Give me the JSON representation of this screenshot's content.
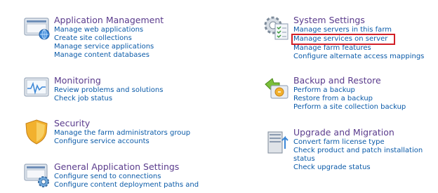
{
  "colors": {
    "title": "#5a3b8c",
    "link": "#0a5aa8",
    "highlight_border": "#d21f27"
  },
  "sections": {
    "app_mgmt": {
      "icon": "application-management-icon",
      "title": "Application Management",
      "links": [
        "Manage web applications",
        "Create site collections",
        "Manage service applications",
        "Manage content databases"
      ]
    },
    "monitoring": {
      "icon": "monitoring-icon",
      "title": "Monitoring",
      "links": [
        "Review problems and solutions",
        "Check job status"
      ]
    },
    "security": {
      "icon": "security-shield-icon",
      "title": "Security",
      "links": [
        "Manage the farm administrators group",
        "Configure service accounts"
      ]
    },
    "general": {
      "icon": "general-settings-icon",
      "title": "General Application Settings",
      "links": [
        "Configure send to connections",
        "Configure content deployment paths and"
      ]
    },
    "system": {
      "icon": "system-settings-icon",
      "title": "System Settings",
      "links": [
        "Manage servers in this farm",
        "Manage services on server",
        "Manage farm features",
        "Configure alternate access mappings"
      ],
      "highlighted": "Manage services on server"
    },
    "backup": {
      "icon": "backup-restore-icon",
      "title": "Backup and Restore",
      "links": [
        "Perform a backup",
        "Restore from a backup",
        "Perform a site collection backup"
      ]
    },
    "upgrade": {
      "icon": "upgrade-migration-icon",
      "title": "Upgrade and Migration",
      "links": [
        "Convert farm license type",
        "Check product and patch installation",
        "status",
        "Check upgrade status"
      ]
    }
  }
}
